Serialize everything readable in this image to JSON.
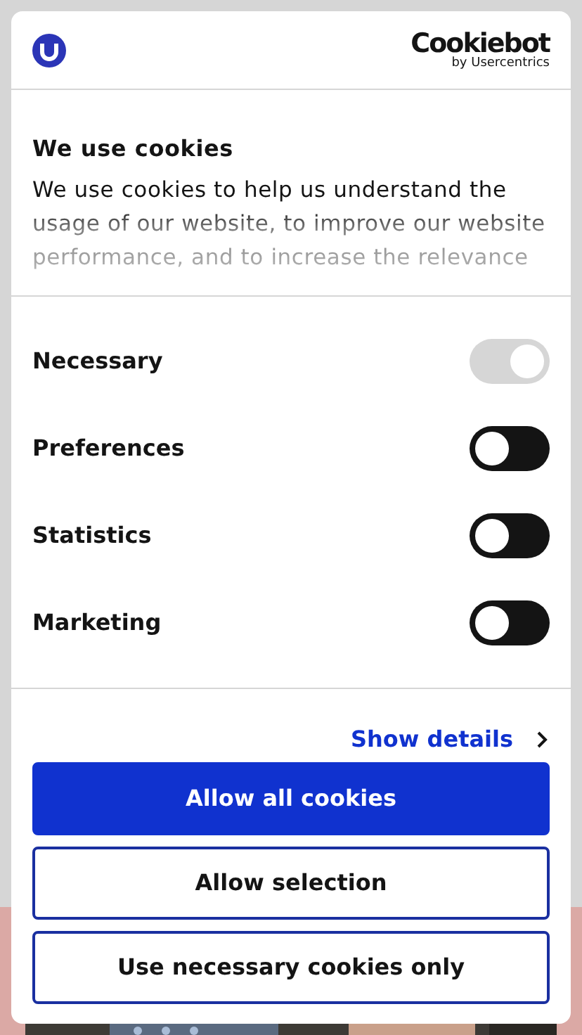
{
  "header": {
    "logo_title": "Cookiebot",
    "logo_subtitle": "by Usercentrics"
  },
  "intro": {
    "title": "We use cookies",
    "description": "We use cookies to help us understand the usage of our website, to improve our website performance, and to increase the relevance"
  },
  "categories": [
    {
      "label": "Necessary",
      "checked": true,
      "disabled": true
    },
    {
      "label": "Preferences",
      "checked": false,
      "disabled": false
    },
    {
      "label": "Statistics",
      "checked": false,
      "disabled": false
    },
    {
      "label": "Marketing",
      "checked": false,
      "disabled": false
    }
  ],
  "details_link": "Show details",
  "buttons": [
    {
      "label": "Allow all cookies",
      "kind": "primary"
    },
    {
      "label": "Allow selection",
      "kind": "outline"
    },
    {
      "label": "Use necessary cookies only",
      "kind": "outline"
    }
  ]
}
